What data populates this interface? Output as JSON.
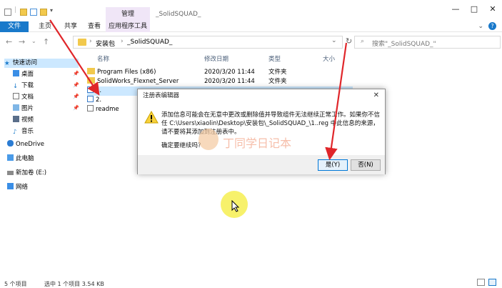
{
  "window": {
    "title": "_SolidSQUAD_",
    "ctx_group": "管理"
  },
  "ribbon": {
    "tabs": [
      {
        "label": "文件"
      },
      {
        "label": "主页"
      },
      {
        "label": "共享"
      },
      {
        "label": "查看"
      },
      {
        "label": "应用程序工具"
      }
    ]
  },
  "address": {
    "crumbs": [
      "安装包",
      "_SolidSQUAD_"
    ],
    "search_placeholder": "搜索\"_SolidSQUAD_\""
  },
  "sidebar": {
    "items": [
      {
        "label": "快速访问",
        "icon": "star-icon"
      },
      {
        "label": "桌面",
        "icon": "desktop-icon"
      },
      {
        "label": "下载",
        "icon": "download-icon"
      },
      {
        "label": "文档",
        "icon": "document-icon"
      },
      {
        "label": "图片",
        "icon": "picture-icon"
      },
      {
        "label": "视频",
        "icon": "video-icon"
      },
      {
        "label": "音乐",
        "icon": "music-icon"
      },
      {
        "label": "OneDrive",
        "icon": "cloud-icon"
      },
      {
        "label": "此电脑",
        "icon": "computer-icon"
      },
      {
        "label": "新加卷 (E:)",
        "icon": "drive-icon"
      },
      {
        "label": "网络",
        "icon": "network-icon"
      }
    ]
  },
  "columns": {
    "name": "名称",
    "date": "修改日期",
    "type": "类型",
    "size": "大小"
  },
  "files": [
    {
      "name": "Program Files (x86)",
      "date": "2020/3/20 11:44",
      "type": "文件夹"
    },
    {
      "name": "SolidWorks_Flexnet_Server",
      "date": "2020/3/20 11:44",
      "type": "文件夹"
    },
    {
      "name": "1.",
      "date": "",
      "type": ""
    },
    {
      "name": "2.",
      "date": "",
      "type": ""
    },
    {
      "name": "readme",
      "date": "",
      "type": ""
    }
  ],
  "status": {
    "count": "5 个项目",
    "selection": "选中 1 个项目  3.54 KB"
  },
  "dialog": {
    "title": "注册表编辑器",
    "message": "添加信息可能会在无意中更改或删除值并导致组件无法继续正常工作。如果你不信任 C:\\Users\\xiaolin\\Desktop\\安装包\\_SolidSQUAD_\\1..reg 中此信息的来源，请不要将其添加到注册表中。",
    "question": "确定要继续吗?",
    "yes_label": "是(Y)",
    "no_label": "否(N)"
  },
  "watermark": "丁同学日记本",
  "colors": {
    "accent": "#1979ca",
    "selection": "#cce8ff",
    "arrow": "#e0262a"
  }
}
